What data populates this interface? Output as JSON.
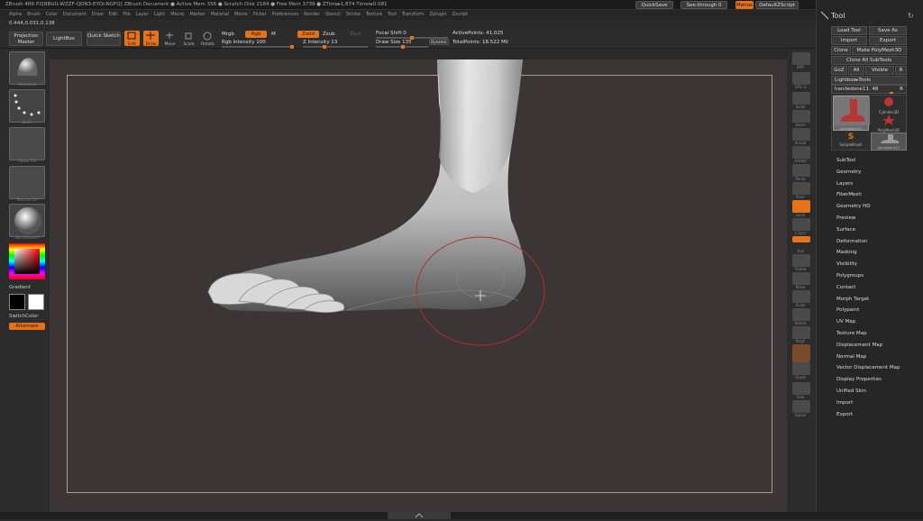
{
  "titlebar": {
    "text": "ZBrush 4R6 P2[BBUG-WZZF-QDN3-EYDI-NGFQ]    ZBrush Document    ● Active Mem 356 ● Scratch Disk 2184 ● Free Mem 3739 ● ZTime▸1.874 Timer▸0.081",
    "quicksave": "QuickSave",
    "seethrough": "See-through  0",
    "menus": "Menus",
    "defaultscript": "DefaultZScript"
  },
  "menubar": {
    "items": [
      "Alpha",
      "Brush",
      "Color",
      "Document",
      "Draw",
      "Edit",
      "File",
      "Layer",
      "Light",
      "Macro",
      "Marker",
      "Material",
      "Movie",
      "Picker",
      "Preferences",
      "Render",
      "Stencil",
      "Stroke",
      "Texture",
      "Tool",
      "Transform",
      "Zplugin",
      "Zscript"
    ]
  },
  "coords": "0.444,0.031,0.138",
  "topshelf": {
    "projection_master": "Projection Master",
    "lightbox": "LightBox",
    "quick_sketch": "Quick Sketch",
    "edit": "Edit",
    "draw": "Draw",
    "move": "Move",
    "scale": "Scale",
    "rotate": "Rotate",
    "mrgb": "Mrgb",
    "rgb": "Rgb",
    "m": "M",
    "rgb_intensity": "Rgb Intensity 100",
    "zadd": "Zadd",
    "zsub": "Zsub",
    "zcut": "Zcut",
    "z_intensity": "Z Intensity 13",
    "focal_shift": "Focal Shift 0",
    "draw_size": "Draw Size 135",
    "dynamic": "Dynamic",
    "active_points": "ActivePoints: 41,025",
    "total_points": "TotalPoints: 18.522 Mil"
  },
  "leftshelf": {
    "standard": "Standard",
    "dots": "Dots",
    "alpha_off": "Alpha Off",
    "texture_off": "Texture Off",
    "material": "SkinShade4",
    "gradient": "Gradient",
    "switchcolor": "SwitchColor",
    "alternate": "Alternate"
  },
  "rightshelf": {
    "items": [
      "BPR",
      "SPix 3",
      "Scroll",
      "Zoom",
      "Actual",
      "AAHalf",
      "Persp",
      "Floor",
      "Local",
      "L.Sym",
      "Xyz",
      "Frame",
      "Move",
      "Scale",
      "Rotate",
      "PolyF",
      "Transp",
      "Ghost",
      "Solo",
      "Xpose"
    ]
  },
  "tray": {
    "title": "Tool",
    "load_tool": "Load Tool",
    "save_as": "Save As",
    "import": "Import",
    "export": "Export",
    "clone": "Clone",
    "make_polymesh": "Make PolyMesh3D",
    "clone_all": "Clone All SubTools",
    "goz": "GoZ",
    "all": "All",
    "visible": "Visible",
    "r": "R",
    "lightbox_tools": "Lightbox▸Tools",
    "current_tool": "handedone11. 48",
    "tools": [
      "handedone11",
      "Cylinder3D",
      "PolyMesh3D",
      "SimpleBrush",
      "handedone11"
    ],
    "menu_items": [
      "SubTool",
      "Geometry",
      "Layers",
      "FiberMesh",
      "Geometry HD",
      "Preview",
      "Surface",
      "Deformation",
      "Masking",
      "Visibility",
      "Polygroups",
      "Contact",
      "Morph Target",
      "Polypaint",
      "UV Map",
      "Texture Map",
      "Displacement Map",
      "Normal Map",
      "Vector Displacement Map",
      "Display Properties",
      "Unified Skin",
      "Import",
      "Export"
    ]
  },
  "colors": {
    "accent": "#e5731a",
    "canvas": "#3c3535",
    "brush_ring": "#b03030"
  }
}
